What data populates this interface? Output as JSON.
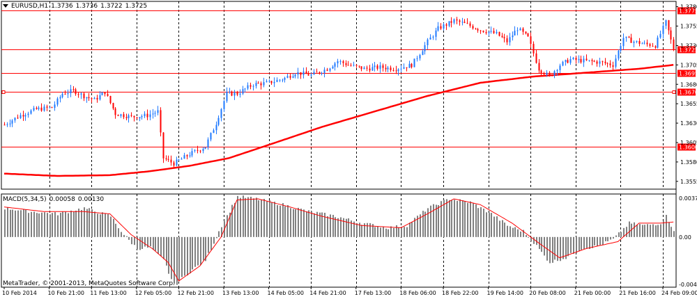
{
  "header": {
    "symbol": "EURUSD,H1",
    "open": "1.3736",
    "high": "1.3736",
    "low": "1.3722",
    "close": "1.3725"
  },
  "macd_header": {
    "name": "MACD(5,34,5)",
    "main": "0.00058",
    "signal": "0.00130"
  },
  "copyright": "MetaTrader, © 2001-2013, MetaQuotes Software Corp.",
  "colors": {
    "bull": "#1e78ff",
    "bear": "#ff0000",
    "level": "#ff0000",
    "ma": "#ff0000",
    "hist": "#808080",
    "signal": "#ff0000",
    "grid": "#000000"
  },
  "chart_data": [
    {
      "type": "candlestick",
      "symbol": "EURUSD",
      "timeframe": "H1",
      "ylim": [
        1.3545,
        1.3785
      ],
      "y_ticks": [
        "1.3780",
        "1.3755",
        "1.3730",
        "1.3705",
        "1.3680",
        "1.3655",
        "1.3630",
        "1.3605",
        "1.3580",
        "1.3555"
      ],
      "y_tick_values": [
        1.378,
        1.3755,
        1.373,
        1.3705,
        1.368,
        1.3655,
        1.363,
        1.3605,
        1.358,
        1.3555
      ],
      "x_ticks": [
        "10 Feb 2014",
        "10 Feb 21:00",
        "11 Feb 13:00",
        "12 Feb 05:00",
        "12 Feb 21:00",
        "13 Feb 13:00",
        "14 Feb 05:00",
        "14 Feb 21:00",
        "17 Feb 13:00",
        "18 Feb 06:00",
        "18 Feb 22:00",
        "19 Feb 14:00",
        "20 Feb 08:00",
        "21 Feb 00:00",
        "21 Feb 16:00",
        "24 Feb 09:00"
      ],
      "price_levels": [
        {
          "value": 1.3775,
          "label": "1.3775"
        },
        {
          "value": 1.3725,
          "label": "1.3725"
        },
        {
          "value": 1.3695,
          "label": "1.3695"
        },
        {
          "value": 1.367,
          "label": "1.3670"
        },
        {
          "value": 1.36,
          "label": "1.3600"
        }
      ],
      "candle_count": 254,
      "close_keypoints": [
        [
          0,
          1.3628
        ],
        [
          6,
          1.364
        ],
        [
          12,
          1.3648
        ],
        [
          18,
          1.365
        ],
        [
          22,
          1.3668
        ],
        [
          26,
          1.3672
        ],
        [
          30,
          1.3665
        ],
        [
          34,
          1.366
        ],
        [
          38,
          1.367
        ],
        [
          42,
          1.3642
        ],
        [
          48,
          1.3638
        ],
        [
          54,
          1.364
        ],
        [
          58,
          1.3645
        ],
        [
          60,
          1.3585
        ],
        [
          64,
          1.3578
        ],
        [
          70,
          1.359
        ],
        [
          76,
          1.36
        ],
        [
          80,
          1.363
        ],
        [
          84,
          1.3668
        ],
        [
          88,
          1.3668
        ],
        [
          94,
          1.368
        ],
        [
          100,
          1.3682
        ],
        [
          106,
          1.3688
        ],
        [
          110,
          1.3695
        ],
        [
          116,
          1.3692
        ],
        [
          122,
          1.37
        ],
        [
          126,
          1.371
        ],
        [
          130,
          1.3705
        ],
        [
          136,
          1.37
        ],
        [
          142,
          1.3702
        ],
        [
          148,
          1.37
        ],
        [
          154,
          1.3705
        ],
        [
          160,
          1.3735
        ],
        [
          164,
          1.3752
        ],
        [
          170,
          1.3762
        ],
        [
          174,
          1.3758
        ],
        [
          180,
          1.375
        ],
        [
          186,
          1.3745
        ],
        [
          190,
          1.3735
        ],
        [
          194,
          1.3752
        ],
        [
          198,
          1.374
        ],
        [
          202,
          1.37
        ],
        [
          206,
          1.369
        ],
        [
          210,
          1.3705
        ],
        [
          214,
          1.3712
        ],
        [
          220,
          1.371
        ],
        [
          226,
          1.3708
        ],
        [
          230,
          1.3705
        ],
        [
          234,
          1.374
        ],
        [
          238,
          1.3735
        ],
        [
          242,
          1.3732
        ],
        [
          246,
          1.373
        ],
        [
          250,
          1.376
        ],
        [
          253,
          1.3725
        ]
      ],
      "ma_keypoints": [
        [
          0,
          1.3565
        ],
        [
          20,
          1.3562
        ],
        [
          40,
          1.3563
        ],
        [
          55,
          1.3568
        ],
        [
          70,
          1.3575
        ],
        [
          85,
          1.3585
        ],
        [
          100,
          1.3602
        ],
        [
          120,
          1.3625
        ],
        [
          140,
          1.3645
        ],
        [
          160,
          1.3665
        ],
        [
          180,
          1.3682
        ],
        [
          200,
          1.369
        ],
        [
          220,
          1.3695
        ],
        [
          240,
          1.37
        ],
        [
          253,
          1.3705
        ]
      ]
    },
    {
      "type": "bar",
      "name": "MACD(5,34,5)",
      "ylim": [
        -0.00434,
        0.00372
      ],
      "y_ticks": [
        "0.00372",
        "0.00",
        "-0.00434"
      ],
      "y_tick_values": [
        0.00372,
        0.0,
        -0.00434
      ],
      "histogram_keypoints": [
        [
          0,
          0.0025
        ],
        [
          10,
          0.0022
        ],
        [
          20,
          0.002
        ],
        [
          30,
          0.0025
        ],
        [
          40,
          0.0018
        ],
        [
          45,
          0.0002
        ],
        [
          50,
          -0.001
        ],
        [
          55,
          -0.0009
        ],
        [
          60,
          -0.002
        ],
        [
          64,
          -0.0042
        ],
        [
          70,
          -0.003
        ],
        [
          76,
          -0.002
        ],
        [
          82,
          0.001
        ],
        [
          88,
          0.0035
        ],
        [
          95,
          0.0033
        ],
        [
          105,
          0.0028
        ],
        [
          115,
          0.0022
        ],
        [
          125,
          0.0018
        ],
        [
          135,
          0.0012
        ],
        [
          145,
          0.0008
        ],
        [
          152,
          0.001
        ],
        [
          160,
          0.0025
        ],
        [
          168,
          0.0033
        ],
        [
          176,
          0.003
        ],
        [
          184,
          0.002
        ],
        [
          190,
          0.001
        ],
        [
          196,
          0.0005
        ],
        [
          200,
          -0.0005
        ],
        [
          206,
          -0.0022
        ],
        [
          212,
          -0.0018
        ],
        [
          218,
          -0.001
        ],
        [
          224,
          -0.0008
        ],
        [
          230,
          -0.0002
        ],
        [
          236,
          0.0012
        ],
        [
          242,
          0.001
        ],
        [
          248,
          0.0012
        ],
        [
          250,
          0.0018
        ],
        [
          253,
          0.0006
        ]
      ],
      "signal_keypoints": [
        [
          0,
          0.0026
        ],
        [
          15,
          0.0022
        ],
        [
          30,
          0.0022
        ],
        [
          40,
          0.002
        ],
        [
          48,
          0.0002
        ],
        [
          56,
          -0.001
        ],
        [
          62,
          -0.0022
        ],
        [
          66,
          -0.0038
        ],
        [
          74,
          -0.0025
        ],
        [
          82,
          0.0
        ],
        [
          88,
          0.0032
        ],
        [
          96,
          0.0033
        ],
        [
          108,
          0.0026
        ],
        [
          120,
          0.0018
        ],
        [
          135,
          0.001
        ],
        [
          150,
          0.0008
        ],
        [
          160,
          0.002
        ],
        [
          170,
          0.0033
        ],
        [
          180,
          0.0028
        ],
        [
          192,
          0.0012
        ],
        [
          202,
          -0.0005
        ],
        [
          210,
          -0.0018
        ],
        [
          220,
          -0.001
        ],
        [
          232,
          -0.0004
        ],
        [
          240,
          0.0012
        ],
        [
          248,
          0.0012
        ],
        [
          253,
          0.0013
        ]
      ]
    }
  ]
}
